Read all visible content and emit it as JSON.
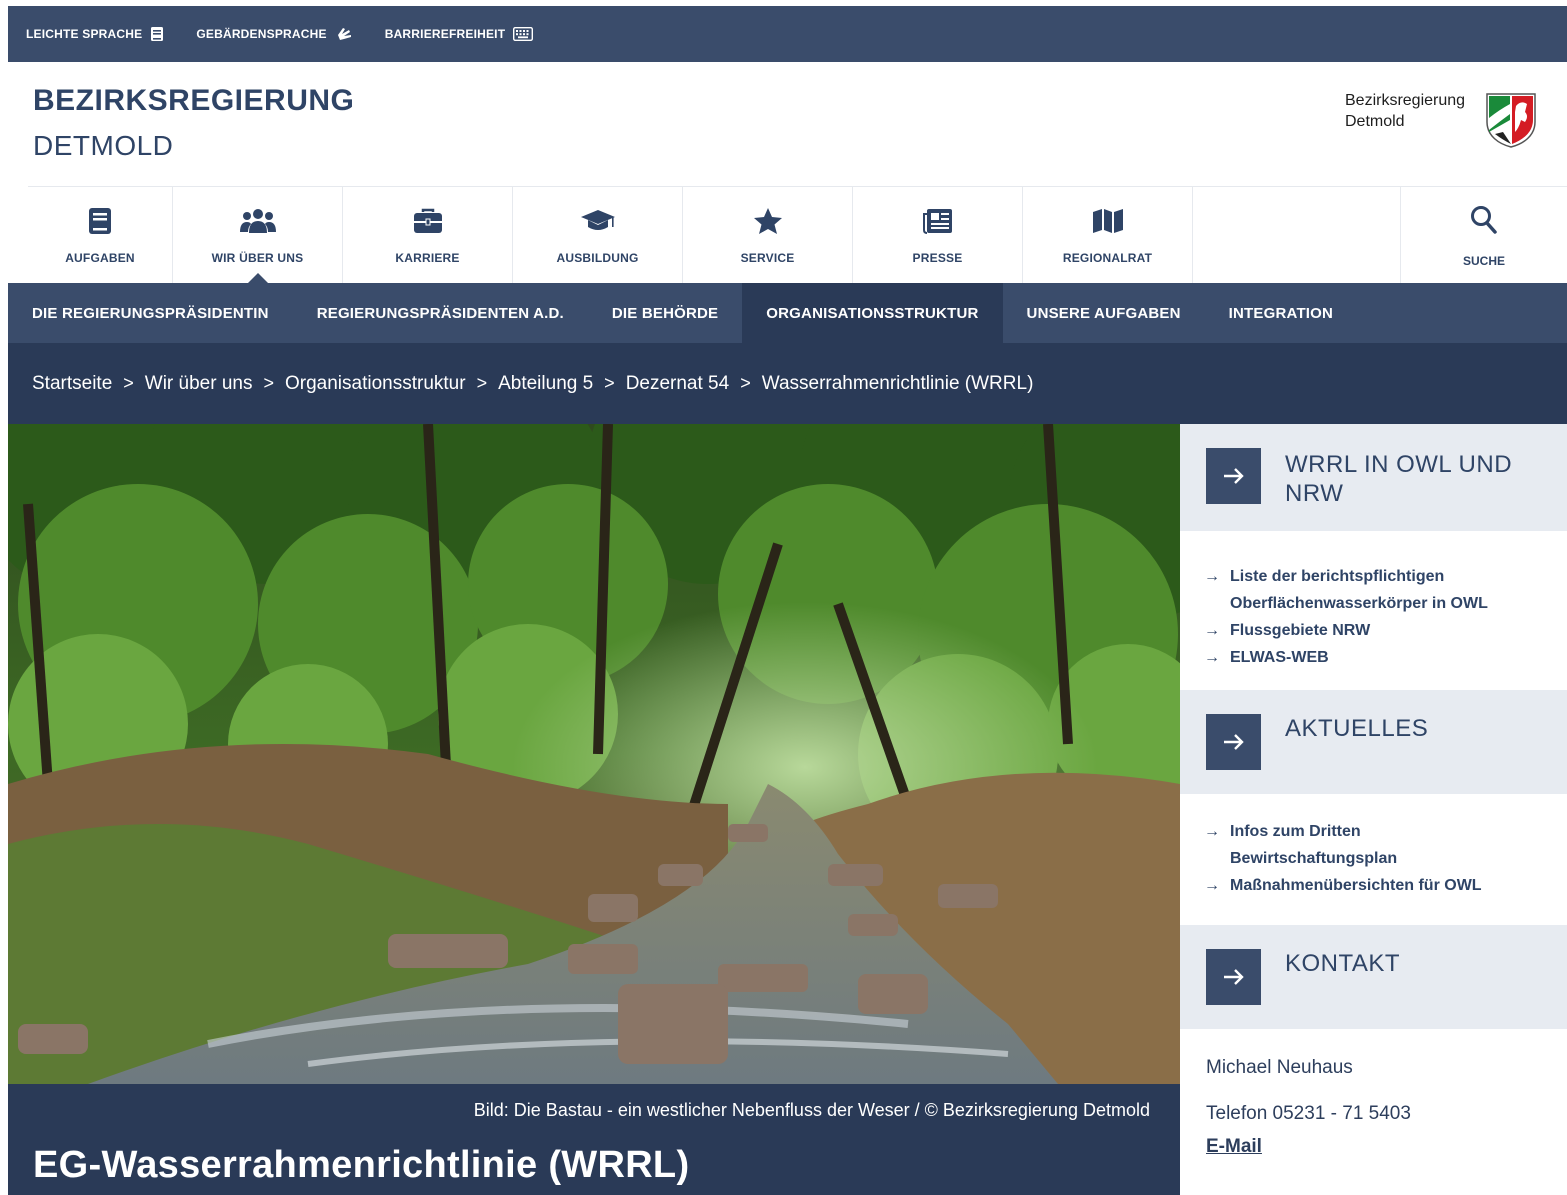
{
  "utility": [
    {
      "label": "LEICHTE SPRACHE",
      "icon": "book-icon"
    },
    {
      "label": "GEBÄRDENSPRACHE",
      "icon": "sign-language-icon"
    },
    {
      "label": "BARRIEREFREIHEIT",
      "icon": "keyboard-icon"
    }
  ],
  "header": {
    "brand_line1": "BEZIRKSREGIERUNG",
    "brand_line2": "DETMOLD",
    "logo_line1": "Bezirksregierung",
    "logo_line2": "Detmold"
  },
  "mainnav": [
    {
      "label": "AUFGABEN",
      "icon": "book-icon"
    },
    {
      "label": "WIR ÜBER UNS",
      "icon": "users-icon"
    },
    {
      "label": "KARRIERE",
      "icon": "briefcase-icon"
    },
    {
      "label": "AUSBILDUNG",
      "icon": "graduation-cap-icon"
    },
    {
      "label": "SERVICE",
      "icon": "star-icon"
    },
    {
      "label": "PRESSE",
      "icon": "newspaper-icon"
    },
    {
      "label": "REGIONALRAT",
      "icon": "map-icon"
    }
  ],
  "search_label": "SUCHE",
  "subnav": [
    "DIE REGIERUNGSPRÄSIDENTIN",
    "REGIERUNGSPRÄSIDENTEN A.D.",
    "DIE BEHÖRDE",
    "ORGANISATIONSSTRUKTUR",
    "UNSERE AUFGABEN",
    "INTEGRATION"
  ],
  "breadcrumb": [
    "Startseite",
    "Wir über uns",
    "Organisationsstruktur",
    "Abteilung 5",
    "Dezernat 54",
    "Wasserrahmenrichtlinie (WRRL)"
  ],
  "breadcrumb_sep": ">",
  "hero": {
    "caption": "Bild: Die Bastau - ein westlicher Nebenfluss der Weser  / © Bezirksregierung Detmold",
    "title": "EG-Wasserrahmenrichtlinie (WRRL)"
  },
  "sidebar": {
    "box1": {
      "title_line1": "WRRL IN OWL UND",
      "title_line2": "NRW",
      "links": [
        {
          "line1": "Liste der berichtspflichtigen",
          "line2": "Oberflächenwasserkörper in OWL"
        },
        {
          "line1": "Flussgebiete NRW",
          "line2": ""
        },
        {
          "line1": "ELWAS-WEB",
          "line2": ""
        }
      ]
    },
    "box2": {
      "title": "AKTUELLES",
      "links": [
        {
          "line1": "Infos zum Dritten",
          "line2": "Bewirtschaftungsplan"
        },
        {
          "line1": "Maßnahmenübersichten für OWL",
          "line2": ""
        }
      ]
    },
    "box3": {
      "title": "KONTAKT",
      "name": "Michael Neuhaus",
      "phone": "Telefon 05231 - 71 5403",
      "email_label": "E-Mail"
    }
  },
  "colors": {
    "primary": "#3a4c6b",
    "dark": "#2a3a57",
    "sidebar_bg": "#e7ebf1"
  }
}
